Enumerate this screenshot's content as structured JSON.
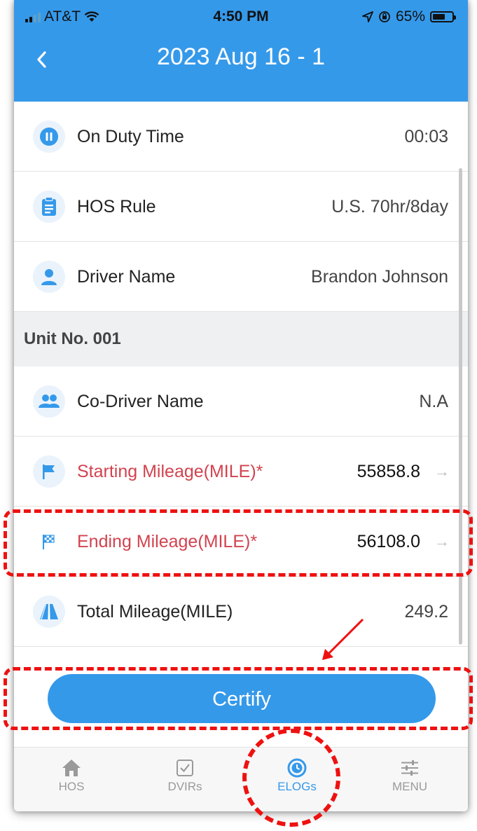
{
  "status_bar": {
    "carrier": "AT&T",
    "time": "4:50 PM",
    "battery": "65%",
    "battery_level": 0.65
  },
  "header": {
    "back_icon": "chevron-left-icon",
    "title": "2023 Aug 16 - 1"
  },
  "rows": [
    {
      "label": "On Duty Time",
      "value": "00:03",
      "icon": "pause-circle-icon"
    },
    {
      "label": "HOS Rule",
      "value": "U.S. 70hr/8day",
      "icon": "clipboard-icon"
    },
    {
      "label": "Driver Name",
      "value": "Brandon Johnson",
      "icon": "person-icon"
    }
  ],
  "section": {
    "label": "Unit No. 001"
  },
  "unit_rows": [
    {
      "label": "Co-Driver Name",
      "value": "N.A",
      "icon": "people-icon"
    },
    {
      "label": "Starting Mileage(MILE)*",
      "value": "55858.8",
      "icon": "flag-icon"
    },
    {
      "label": "Ending Mileage(MILE)*",
      "value": "56108.0",
      "icon": "checkered-flag-icon"
    },
    {
      "label": "Total Mileage(MILE)",
      "value": "249.2",
      "icon": "road-icon"
    }
  ],
  "certify_label": "Certify",
  "tabs": [
    {
      "label": "HOS",
      "icon": "home-icon"
    },
    {
      "label": "DVIRs",
      "icon": "checkbox-icon"
    },
    {
      "label": "ELOGs",
      "icon": "clock-icon"
    },
    {
      "label": "MENU",
      "icon": "sliders-icon"
    }
  ],
  "colors": {
    "accent": "#3599ea",
    "required_label": "#d2434f",
    "annotation": "#ee1111"
  }
}
